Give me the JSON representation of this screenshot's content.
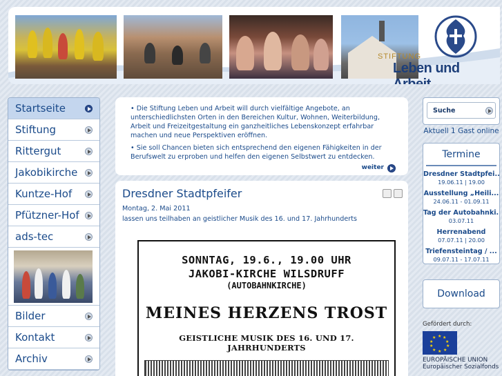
{
  "header": {
    "logo_small": "STIFTUNG",
    "logo_big": "Leben und Arbeit"
  },
  "nav": {
    "items": [
      {
        "label": "Startseite",
        "active": true
      },
      {
        "label": "Stiftung"
      },
      {
        "label": "Rittergut"
      },
      {
        "label": "Jakobikirche"
      },
      {
        "label": "Kuntze-Hof"
      },
      {
        "label": "Pfützner-Hof"
      },
      {
        "label": "ads-tec"
      },
      {
        "label": "Bilder"
      },
      {
        "label": "Kontakt"
      },
      {
        "label": "Archiv"
      }
    ]
  },
  "intro": {
    "para1": "• Die Stiftung Leben und Arbeit will durch vielfältige Angebote, an unterschiedlichsten Orten in den Bereichen Kultur, Wohnen, Weiterbildung, Arbeit und Freizeitgestaltung ein ganzheitliches Lebenskonzept erfahrbar machen und neue Perspektiven eröffnen.",
    "para2": "• Sie soll Chancen bieten sich entsprechend den eigenen Fähigkeiten in der Berufswelt zu erproben und helfen den eigenen Selbstwert zu entdecken.",
    "more_label": "weiter"
  },
  "article": {
    "title": "Dresdner Stadtpfeifer",
    "date": "Montag, 2. Mai 2011",
    "text": "lassen uns teilhaben an geistlicher Musik des 16. und 17. Jahrhunderts",
    "poster": {
      "line1": "SONNTAG, 19.6., 19.00 UHR",
      "line2": "JAKOBI-KIRCHE WILSDRUFF",
      "line3": "(AUTOBAHNKIRCHE)",
      "line4": "MEINES HERZENS TROST",
      "line5": "GEISTLICHE MUSIK DES 16. UND 17. JAHRHUNDERTS"
    }
  },
  "search": {
    "label": "Suche"
  },
  "online": "Aktuell 1 Gast online",
  "termine": {
    "heading": "Termine",
    "events": [
      {
        "title": "Dresdner Stadtpfei...",
        "date": "19.06.11 | 19.00"
      },
      {
        "title": "Ausstellung „Heili...",
        "date": "24.06.11 - 01.09.11"
      },
      {
        "title": "Tag der Autobahnki...",
        "date": "03.07.11"
      },
      {
        "title": "Herrenabend",
        "date": "07.07.11 | 20.00"
      },
      {
        "title": "Triefensteintag / ...",
        "date": "09.07.11 - 17.07.11"
      }
    ]
  },
  "download": {
    "label": "Download"
  },
  "eu": {
    "funded_by": "Gefördert durch:",
    "line1": "EUROPÄISCHE UNION",
    "line2": "Europäischer Sozialfonds"
  }
}
